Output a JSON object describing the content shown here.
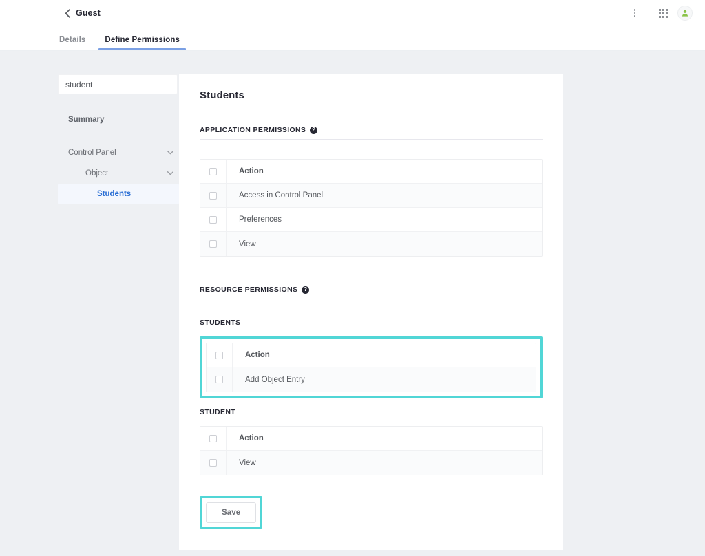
{
  "header": {
    "back_icon": "back-chevron-icon",
    "title": "Guest",
    "kebab_icon": "vertical-dots-icon",
    "apps_icon": "grid-apps-icon",
    "avatar_icon": "user-avatar-icon"
  },
  "tabs": [
    {
      "label": "Details",
      "active": false
    },
    {
      "label": "Define Permissions",
      "active": true
    }
  ],
  "sidebar": {
    "search": {
      "value": "student",
      "placeholder": "Search"
    },
    "items": [
      {
        "label": "Summary",
        "level": 0,
        "chevron": false,
        "current": false
      },
      {
        "label": "Control Panel",
        "level": 1,
        "chevron": true,
        "current": false
      },
      {
        "label": "Object",
        "level": 2,
        "chevron": true,
        "current": false
      },
      {
        "label": "Students",
        "level": 3,
        "chevron": false,
        "current": true
      }
    ]
  },
  "main": {
    "title": "Students",
    "application_permissions": {
      "heading": "APPLICATION PERMISSIONS",
      "help_glyph": "?",
      "column_header": "Action",
      "rows": [
        {
          "label": "Access in Control Panel",
          "checked": false
        },
        {
          "label": "Preferences",
          "checked": false
        },
        {
          "label": "View",
          "checked": false
        }
      ]
    },
    "resource_permissions": {
      "heading": "RESOURCE PERMISSIONS",
      "help_glyph": "?",
      "groups": [
        {
          "name": "STUDENTS",
          "highlighted": true,
          "column_header": "Action",
          "rows": [
            {
              "label": "Add Object Entry",
              "checked": false
            }
          ]
        },
        {
          "name": "STUDENT",
          "highlighted": false,
          "column_header": "Action",
          "rows": [
            {
              "label": "View",
              "checked": false
            }
          ]
        }
      ]
    },
    "save_label": "Save",
    "save_highlighted": true
  },
  "colors": {
    "highlight_teal": "#51d6d6",
    "tab_active_blue": "#7ba0e4",
    "sidebar_current_blue": "#2b6fd4",
    "page_background": "#eef0f3",
    "card_background": "#ffffff",
    "avatar_green": "#8bc34a"
  }
}
